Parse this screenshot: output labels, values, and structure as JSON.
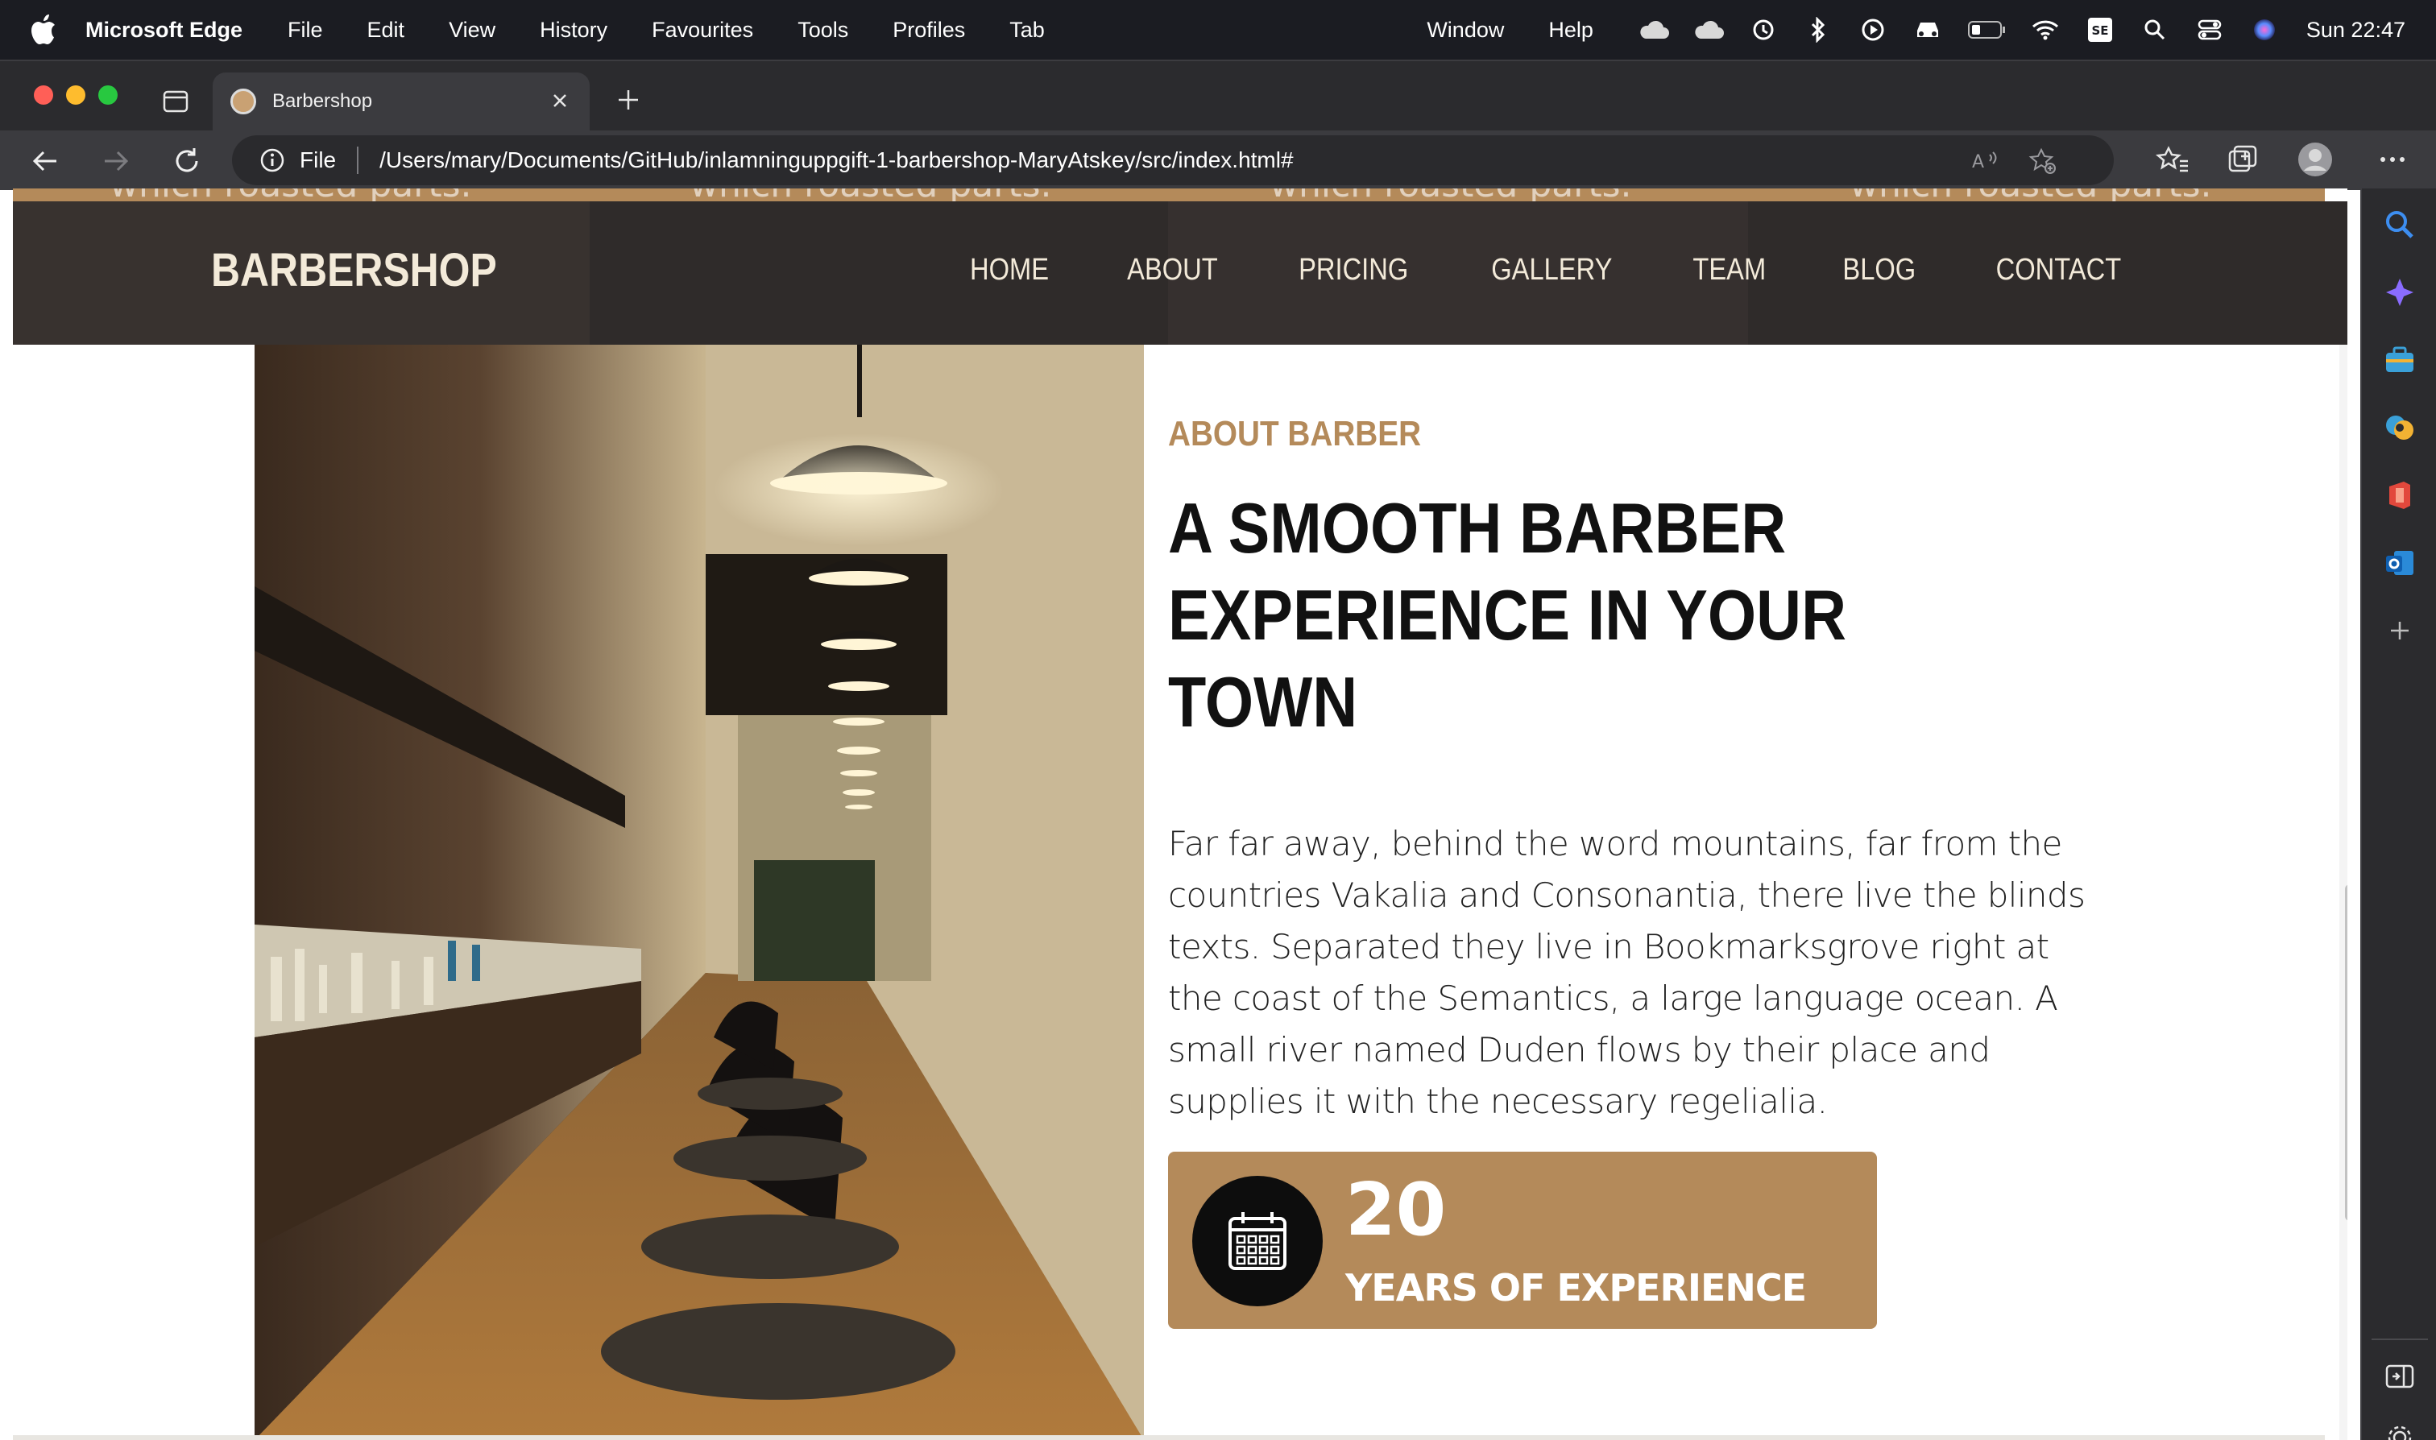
{
  "menubar": {
    "app_name": "Microsoft Edge",
    "menus": [
      "File",
      "Edit",
      "View",
      "History",
      "Favourites",
      "Tools",
      "Profiles",
      "Tab"
    ],
    "right_menus": [
      "Window",
      "Help"
    ],
    "clock": "Sun  22:47",
    "status_icons": [
      "cloud-icon",
      "cloud-icon",
      "time-machine-icon",
      "bluetooth-icon",
      "play-icon",
      "car-icon",
      "battery-icon",
      "wifi-icon",
      "input-source-icon",
      "spotlight-search-icon",
      "control-center-icon",
      "siri-icon"
    ]
  },
  "browser": {
    "tab_title": "Barbershop",
    "address_scheme": "File",
    "address_url": "/Users/mary/Documents/GitHub/inlamninguppgift-1-barbershop-MaryAtskey/src/index.html#"
  },
  "page": {
    "marquee_text": "which roasted parts.",
    "brand": "BARBERSHOP",
    "nav": [
      "HOME",
      "ABOUT",
      "PRICING",
      "GALLERY",
      "TEAM",
      "BLOG",
      "CONTACT"
    ],
    "eyebrow": "ABOUT BARBER",
    "headline": "A SMOOTH BARBER EXPERIENCE IN YOUR TOWN",
    "paragraph": "Far far away, behind the word mountains, far from the countries Vakalia and Consonantia, there live the blinds texts. Separated they live in Bookmarksgrove right at the coast of the Semantics, a large language ocean. A small river named Duden flows by their place and supplies it with the necessary regelialia.",
    "stat_number": "20",
    "stat_label": "YEARS OF EXPERIENCE"
  },
  "colors": {
    "accent": "#b48a5a",
    "header_bg": "#363130",
    "header_text": "#f3ead9",
    "heading": "#111111"
  }
}
